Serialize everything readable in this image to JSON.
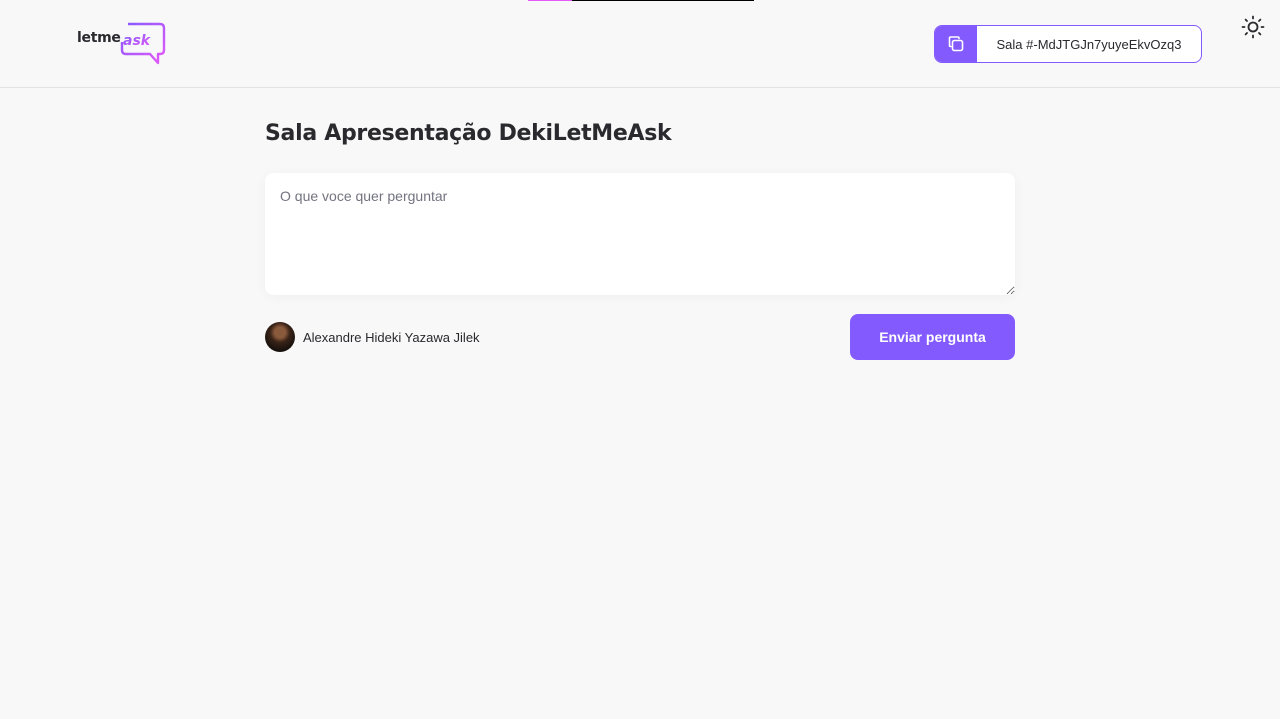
{
  "header": {
    "logo": {
      "word1": "letme",
      "word2": "ask"
    },
    "room_code": {
      "label": "Sala #-MdJTGJn7yuyeEkvOzq3",
      "icon": "copy-icon"
    },
    "theme_toggle": {
      "icon": "sun-icon"
    }
  },
  "main": {
    "room_title": "Sala Apresentação DekiLetMeAsk",
    "question_placeholder": "O que voce quer perguntar",
    "question_value": "",
    "user": {
      "name": "Alexandre Hideki Yazawa Jilek"
    },
    "send_label": "Enviar pergunta"
  },
  "colors": {
    "primary": "#835afd",
    "background": "#f8f8f8",
    "text": "#29292e",
    "logo_gradient_start": "#835afd",
    "logo_gradient_end": "#e559f9"
  }
}
